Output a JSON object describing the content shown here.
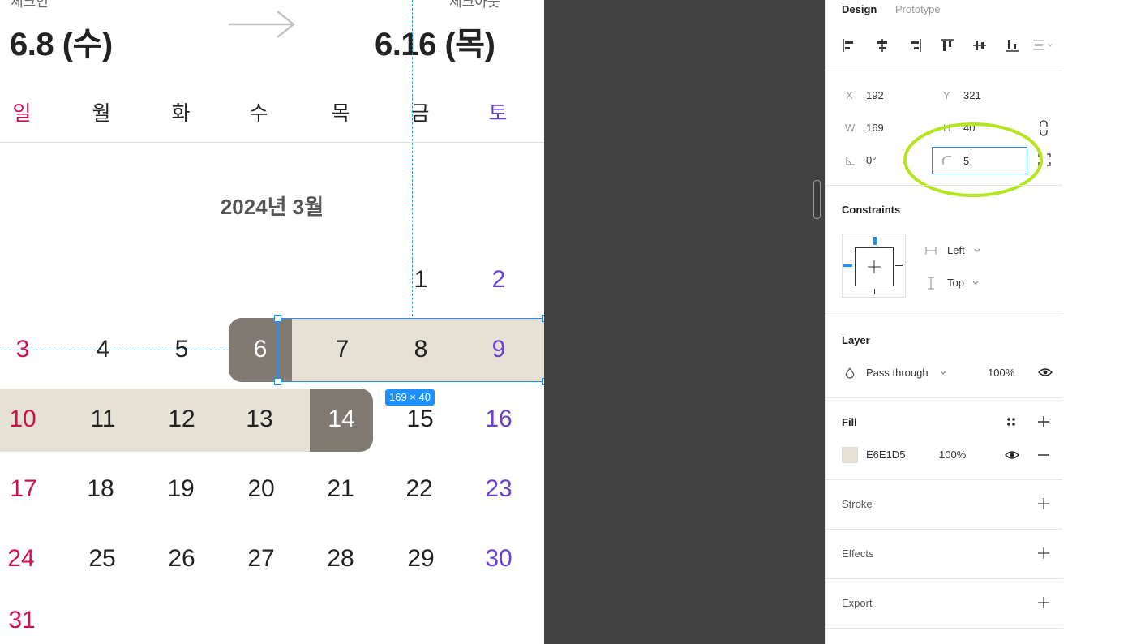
{
  "calendar": {
    "checkin_label": "체크인",
    "checkin_date": "6.8 (수)",
    "checkout_label": "체크아웃",
    "checkout_date": "6.16 (목)",
    "weekdays": [
      "일",
      "월",
      "화",
      "수",
      "목",
      "금",
      "토"
    ],
    "month_title": "2024년 3월",
    "days": [
      "1",
      "2",
      "3",
      "4",
      "5",
      "6",
      "7",
      "8",
      "9",
      "10",
      "11",
      "12",
      "13",
      "14",
      "15",
      "16",
      "17",
      "18",
      "19",
      "20",
      "21",
      "22",
      "23",
      "24",
      "25",
      "26",
      "27",
      "28",
      "29",
      "30",
      "31"
    ],
    "selection_size": "169 × 40"
  },
  "panel": {
    "tabs": {
      "design": "Design",
      "prototype": "Prototype"
    },
    "x_label": "X",
    "x_value": "192",
    "y_label": "Y",
    "y_value": "321",
    "w_label": "W",
    "w_value": "169",
    "h_label": "H",
    "h_value": "40",
    "rotation_value": "0°",
    "radius_value": "5",
    "constraints": {
      "title": "Constraints",
      "horizontal": "Left",
      "vertical": "Top"
    },
    "layer": {
      "title": "Layer",
      "blend": "Pass through",
      "opacity": "100%"
    },
    "fill": {
      "title": "Fill",
      "hex": "E6E1D5",
      "opacity": "100%"
    },
    "stroke": {
      "title": "Stroke"
    },
    "effects": {
      "title": "Effects"
    },
    "export": {
      "title": "Export"
    }
  },
  "colors": {
    "sunday": "#d0104c",
    "saturday": "#6a3fd1",
    "range_fill": "#e6e1d5",
    "endpoint_fill": "#807a72",
    "selection_blue": "#1e90ff",
    "highlight_circle": "#b5e61d"
  },
  "icons": [
    "arrow-right-icon",
    "align-left-icon",
    "align-center-h-icon",
    "align-right-icon",
    "align-top-icon",
    "align-middle-icon",
    "align-bottom-icon",
    "distribute-icon",
    "rotation-icon",
    "corner-radius-icon",
    "constrain-proportions-icon",
    "independent-corners-icon",
    "horizontal-constraint-icon",
    "vertical-constraint-icon",
    "blend-icon",
    "eye-icon",
    "style-grid-icon",
    "plus-icon",
    "minus-icon"
  ]
}
